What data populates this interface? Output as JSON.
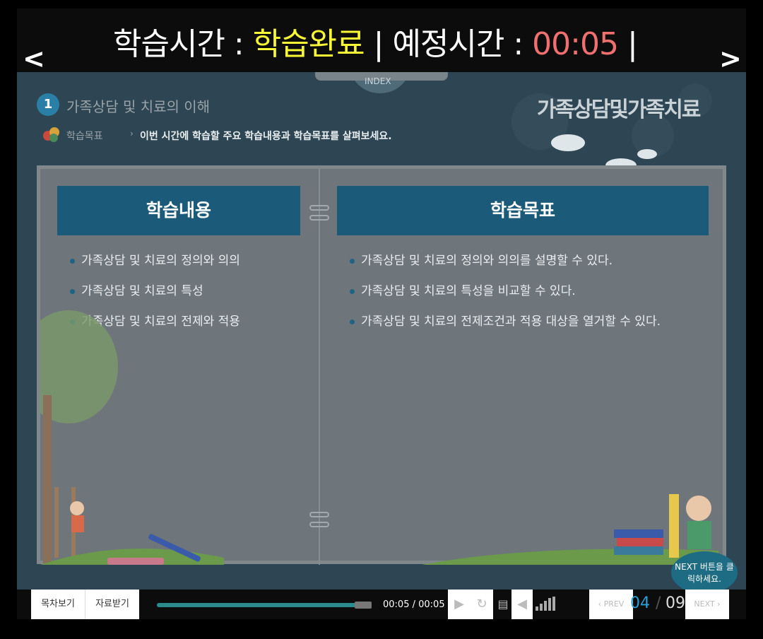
{
  "status": {
    "study_time_label": "학습시간 : ",
    "study_time_value": "학습완료",
    "divider1": " | ",
    "scheduled_label": "예정시간 : ",
    "scheduled_value": "00:05",
    "divider2": " |"
  },
  "nav": {
    "prev": "<",
    "next": ">"
  },
  "index_label": "INDEX",
  "section": {
    "number": "1",
    "title": "가족상담 및 치료의 이해"
  },
  "brand_title": "가족상담및가족치료",
  "objective": {
    "label": "학습목표",
    "separator": "›",
    "text": "이번 시간에 학습할 주요 학습내용과 학습목표를 살펴보세요."
  },
  "content": {
    "header": "학습내용",
    "items": [
      "가족상담 및 치료의 정의와 의의",
      "가족상담 및 치료의 특성",
      "가족상담 및 치료의 전제와 적용"
    ]
  },
  "goals": {
    "header": "학습목표",
    "items": [
      "가족상담 및 치료의 정의와 의의를 설명할 수 있다.",
      "가족상담 및 치료의 특성을 비교할 수 있다.",
      "가족상담 및 치료의 전제조건과 적용 대상을 열거할 수 있다."
    ]
  },
  "next_hint": "NEXT 버튼을 클릭하세요.",
  "controls": {
    "toc": "목차보기",
    "resources": "자료받기",
    "time_current": "00:05",
    "time_total": "/ 00:05",
    "progress": 1.0,
    "prev": "PREV",
    "next": "NEXT",
    "page_current": "04",
    "page_sep": "/",
    "page_total": "09"
  },
  "colors": {
    "accent": "#2a7fa7",
    "header_bg": "#1b5a78",
    "highlight": "#f7f735",
    "time_red": "#f07070"
  }
}
